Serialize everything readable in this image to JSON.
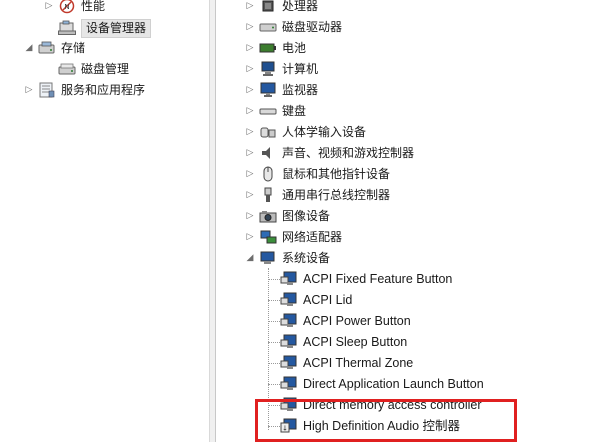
{
  "left_tree": {
    "items": [
      {
        "label": "性能",
        "icon": "performance-icon",
        "expander": "▷"
      },
      {
        "label": "设备管理器",
        "icon": "device-manager-icon",
        "expander": ""
      },
      {
        "label": "存储",
        "icon": "storage-icon",
        "expander": "◢"
      },
      {
        "label": "磁盘管理",
        "icon": "disk-management-icon",
        "expander": ""
      },
      {
        "label": "服务和应用程序",
        "icon": "services-icon",
        "expander": "▷"
      }
    ]
  },
  "device_tree": {
    "categories": [
      {
        "label": "处理器",
        "icon": "processor-icon"
      },
      {
        "label": "磁盘驱动器",
        "icon": "disk-drive-icon"
      },
      {
        "label": "电池",
        "icon": "battery-icon"
      },
      {
        "label": "计算机",
        "icon": "computer-icon"
      },
      {
        "label": "监视器",
        "icon": "monitor-icon"
      },
      {
        "label": "键盘",
        "icon": "keyboard-icon"
      },
      {
        "label": "人体学输入设备",
        "icon": "hid-icon"
      },
      {
        "label": "声音、视频和游戏控制器",
        "icon": "sound-icon"
      },
      {
        "label": "鼠标和其他指针设备",
        "icon": "mouse-icon"
      },
      {
        "label": "通用串行总线控制器",
        "icon": "usb-icon"
      },
      {
        "label": "图像设备",
        "icon": "imaging-icon"
      },
      {
        "label": "网络适配器",
        "icon": "network-icon"
      },
      {
        "label": "系统设备",
        "icon": "system-devices-icon"
      }
    ],
    "system_devices": [
      "ACPI Fixed Feature Button",
      "ACPI Lid",
      "ACPI Power Button",
      "ACPI Sleep Button",
      "ACPI Thermal Zone",
      "Direct Application Launch Button",
      "Direct memory access controller",
      "High Definition Audio 控制器"
    ]
  },
  "colors": {
    "highlight": "#e02020",
    "selection": "#e6e6e6"
  }
}
